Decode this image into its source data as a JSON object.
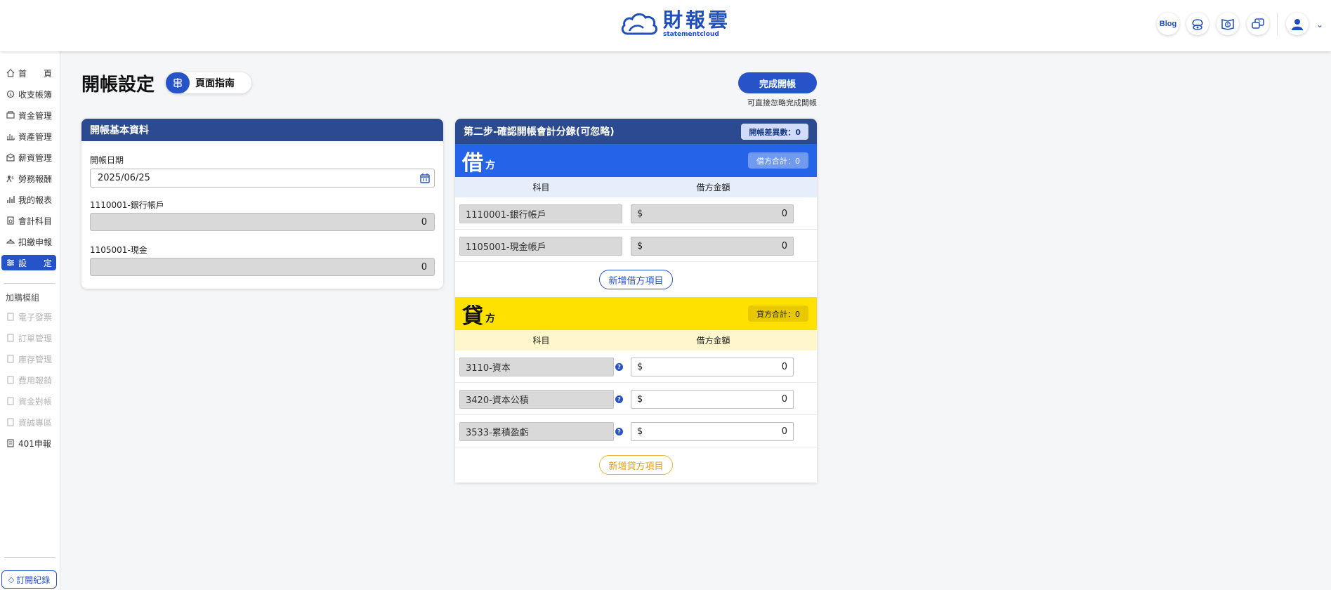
{
  "header": {
    "logo_cn": "財報雲",
    "logo_en": "statementcloud",
    "blog_label": "Blog",
    "icons": [
      "brain-eye-icon",
      "book-dollar-icon",
      "chat-help-icon",
      "user-avatar-icon"
    ]
  },
  "sidebar": {
    "items": [
      {
        "label": "首頁",
        "label_a": "首",
        "label_b": "頁",
        "icon": "home-icon"
      },
      {
        "label": "收支帳簿",
        "icon": "ledger-icon"
      },
      {
        "label": "資金管理",
        "icon": "fund-icon"
      },
      {
        "label": "資產管理",
        "icon": "asset-icon"
      },
      {
        "label": "薪資管理",
        "icon": "salary-icon"
      },
      {
        "label": "勞務報酬",
        "icon": "labor-icon"
      },
      {
        "label": "我的報表",
        "icon": "report-icon"
      },
      {
        "label": "會計科目",
        "icon": "account-icon"
      },
      {
        "label": "扣繳申報",
        "icon": "withholding-icon"
      },
      {
        "label": "設定",
        "label_a": "設",
        "label_b": "定",
        "icon": "settings-icon",
        "active": true
      }
    ],
    "section_title": "加購模組",
    "addon_items": [
      {
        "label": "電子發票",
        "icon": "invoice-icon",
        "disabled": true
      },
      {
        "label": "訂單管理",
        "icon": "order-icon",
        "disabled": true
      },
      {
        "label": "庫存管理",
        "icon": "inventory-icon",
        "disabled": true
      },
      {
        "label": "費用報銷",
        "icon": "expense-icon",
        "disabled": true
      },
      {
        "label": "資金對帳",
        "icon": "reconcile-icon",
        "disabled": true
      },
      {
        "label": "資誠專區",
        "icon": "pwc-icon",
        "disabled": true
      },
      {
        "label": "401申報",
        "icon": "tax401-icon",
        "disabled": false
      }
    ],
    "subscription_label": "訂閱紀錄"
  },
  "page": {
    "title": "開帳設定",
    "guide_label": "頁面指南",
    "done_label": "完成開帳",
    "done_note": "可直接忽略完成開帳"
  },
  "basic_card": {
    "title": "開帳基本資料",
    "date_label": "開帳日期",
    "date_value": "2025/06/25",
    "fields": [
      {
        "label": "1110001-銀行帳戶",
        "value": "0"
      },
      {
        "label": "1105001-現金",
        "value": "0"
      }
    ]
  },
  "entry_card": {
    "title": "第二步-確認開帳會計分錄(可忽略)",
    "diff_label": "開帳差異數：0",
    "debit": {
      "big": "借",
      "small": "方",
      "total": "借方合計：0",
      "col_account": "科目",
      "col_amount": "借方金額",
      "rows": [
        {
          "account": "1110001-銀行帳戶",
          "currency": "$",
          "amount": "0"
        },
        {
          "account": "1105001-現金帳戶",
          "currency": "$",
          "amount": "0"
        }
      ],
      "add_label": "新增借方項目"
    },
    "credit": {
      "big": "貸",
      "small": "方",
      "total": "貸方合計：0",
      "col_account": "科目",
      "col_amount": "借方金額",
      "rows": [
        {
          "account": "3110-資本",
          "currency": "$",
          "amount": "0"
        },
        {
          "account": "3420-資本公積",
          "currency": "$",
          "amount": "0"
        },
        {
          "account": "3533-累積盈虧",
          "currency": "$",
          "amount": "0"
        }
      ],
      "add_label": "新增貸方項目"
    }
  },
  "colors": {
    "primary": "#2753c8",
    "header_navy": "#2b4a8f",
    "debit_blue": "#2563e8",
    "credit_yellow": "#ffe100"
  }
}
